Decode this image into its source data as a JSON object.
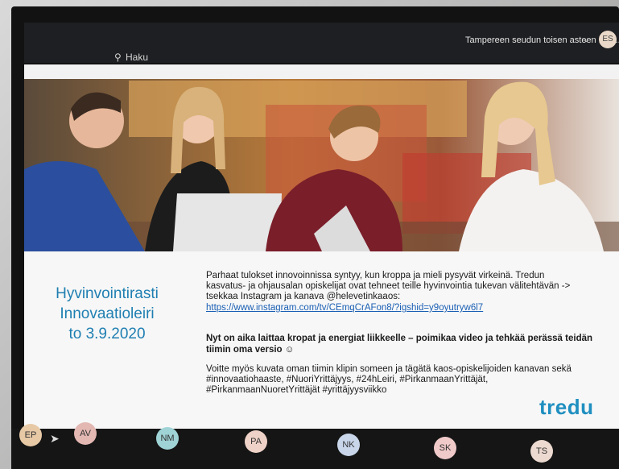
{
  "topbar": {
    "search_label": "Haku",
    "org_name": "Tampereen seudun toisen asteen kou...",
    "chevron": "⌄",
    "user_initials": "ES"
  },
  "slide": {
    "title_lines": [
      "Hyvinvointirasti",
      "Innovaatioleiri",
      "to 3.9.2020"
    ],
    "paragraph1_lines": [
      "Parhaat tulokset innovoinnissa syntyy, kun kroppa ja mieli pysyvät virkeinä. Tredun",
      "kasvatus- ja ohjausalan opiskelijat ovat tehneet teille hyvinvointia tukevan välitehtävän ->",
      "tsekkaa Instagram ja kanava @helevetinkaaos:"
    ],
    "link": "https://www.instagram.com/tv/CEmqCrAFon8/?igshid=y9oyutryw6l7",
    "paragraph2_lines": [
      "Nyt on aika laittaa kropat ja energiat liikkeelle – poimikaa video ja tehkää perässä teidän",
      "tiimin oma versio ☺"
    ],
    "paragraph3_lines": [
      "Voitte myös kuvata oman tiimin klipin someen ja tägätä kaos-opiskelijoiden kanavan sekä",
      "#innovaatiohaaste, #NuoriYrittäjyys, #24hLeiri, #PirkanmaanYrittäjät,",
      "#PirkanmaanNuoretYrittäjät #yrittäjyysviikko"
    ],
    "logo": "tredu"
  },
  "participants": [
    {
      "initials": "EP",
      "color": "#e7c9a6"
    },
    {
      "initials": "AV",
      "color": "#e3b7b2"
    },
    {
      "initials": "NM",
      "color": "#9fd3d6"
    },
    {
      "initials": "PA",
      "color": "#efd2c7"
    },
    {
      "initials": "NK",
      "color": "#c9d6ea"
    },
    {
      "initials": "SK",
      "color": "#f0c9c9"
    },
    {
      "initials": "TS",
      "color": "#ecd9cf"
    }
  ]
}
